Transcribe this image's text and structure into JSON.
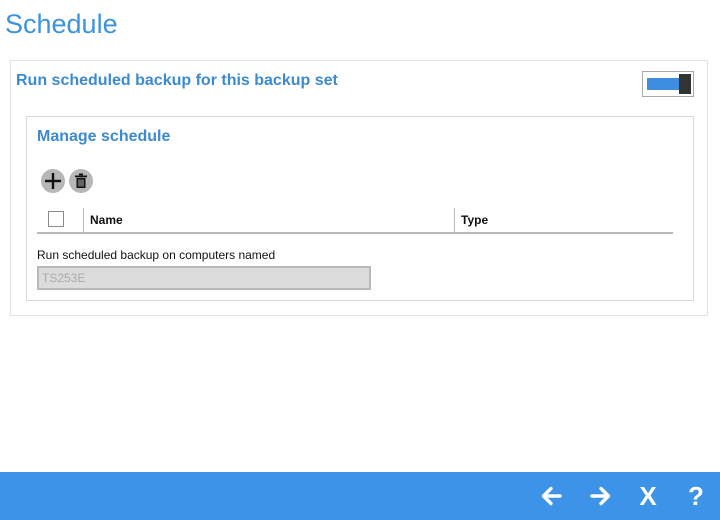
{
  "page": {
    "title": "Schedule"
  },
  "schedule_section": {
    "title": "Run scheduled backup for this backup set",
    "toggle_state": "on"
  },
  "manage_schedule": {
    "title": "Manage schedule",
    "add_icon": "plus-icon",
    "delete_icon": "trash-icon",
    "table": {
      "columns": [
        "Name",
        "Type"
      ],
      "rows": []
    },
    "computers_label": "Run scheduled backup on computers named",
    "computers_value": "TS253E"
  },
  "bottom_bar": {
    "buttons": [
      "back-arrow-icon",
      "forward-arrow-icon",
      "close-x-icon",
      "help-question-icon"
    ],
    "close_label": "X",
    "help_label": "?"
  },
  "colors": {
    "accent": "#3d93e8",
    "heading": "#3d8ad0",
    "toggle_knob": "#333333"
  }
}
